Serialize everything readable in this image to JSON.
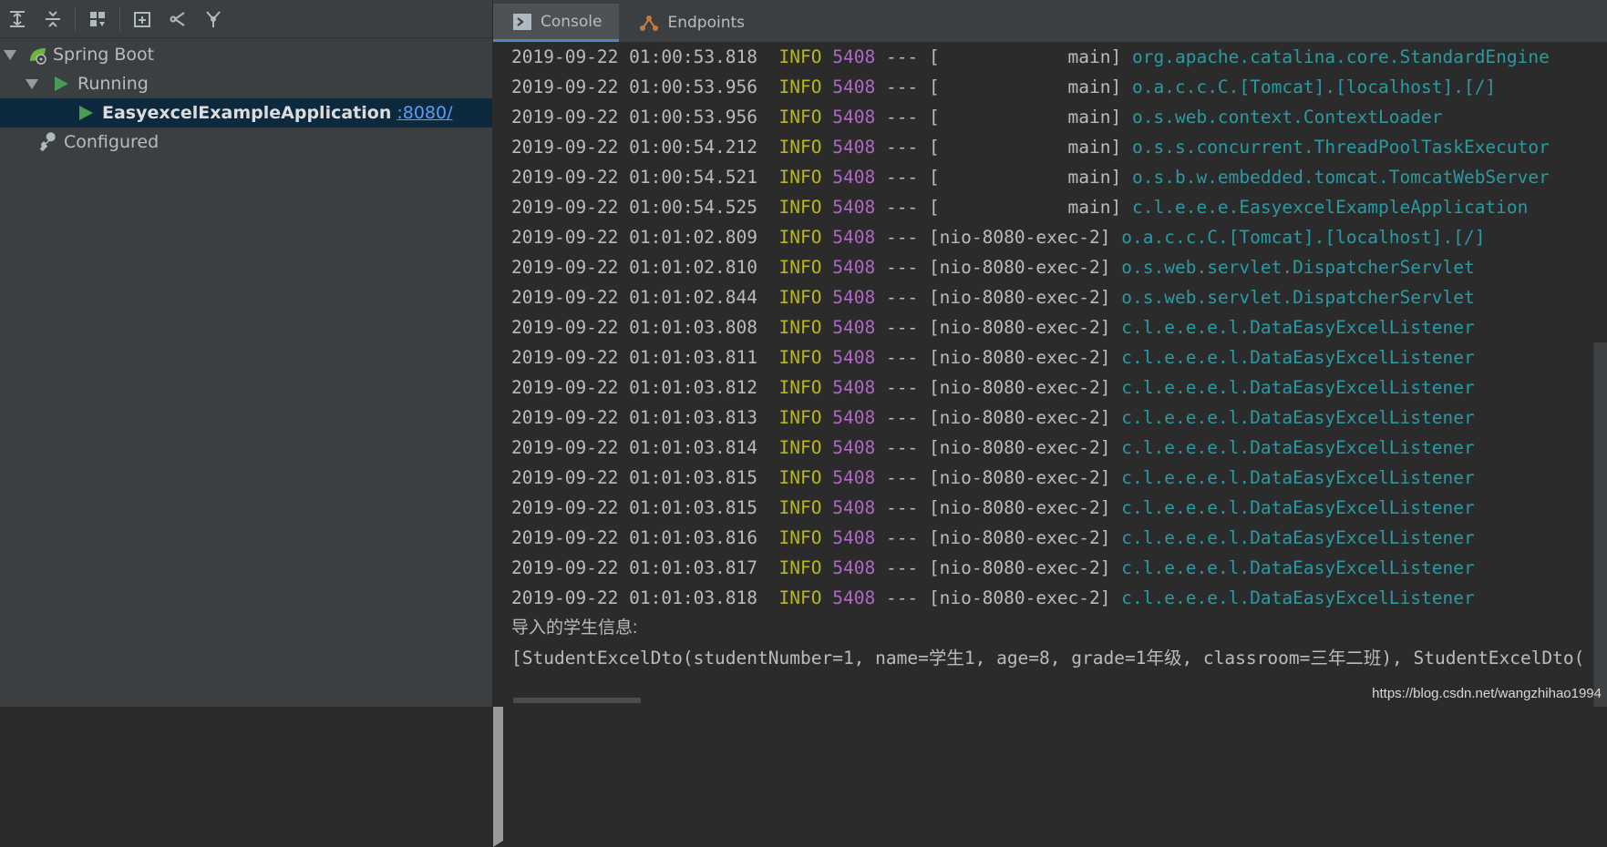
{
  "toolbar": {
    "icons": [
      "expand-all-icon",
      "collapse-all-icon",
      "group-by-icon",
      "new-service-icon",
      "filter-icon",
      "fork-icon"
    ]
  },
  "tree": {
    "root": {
      "label": "Spring Boot"
    },
    "running": {
      "label": "Running"
    },
    "app": {
      "label": "EasyexcelExampleApplication",
      "port_link": ":8080/"
    },
    "configured": {
      "label": "Configured"
    }
  },
  "tabs": [
    {
      "label": "Console",
      "icon": "console-icon",
      "active": true
    },
    {
      "label": "Endpoints",
      "icon": "endpoints-icon",
      "active": false
    }
  ],
  "console": {
    "lines": [
      {
        "date": "2019-09-22 01:00:53.818",
        "level": "INFO",
        "pid": "5408",
        "sep": "---",
        "thread": "[            main]",
        "logger": "org.apache.catalina.core.StandardEngine"
      },
      {
        "date": "2019-09-22 01:00:53.956",
        "level": "INFO",
        "pid": "5408",
        "sep": "---",
        "thread": "[            main]",
        "logger": "o.a.c.c.C.[Tomcat].[localhost].[/]"
      },
      {
        "date": "2019-09-22 01:00:53.956",
        "level": "INFO",
        "pid": "5408",
        "sep": "---",
        "thread": "[            main]",
        "logger": "o.s.web.context.ContextLoader"
      },
      {
        "date": "2019-09-22 01:00:54.212",
        "level": "INFO",
        "pid": "5408",
        "sep": "---",
        "thread": "[            main]",
        "logger": "o.s.s.concurrent.ThreadPoolTaskExecutor"
      },
      {
        "date": "2019-09-22 01:00:54.521",
        "level": "INFO",
        "pid": "5408",
        "sep": "---",
        "thread": "[            main]",
        "logger": "o.s.b.w.embedded.tomcat.TomcatWebServer"
      },
      {
        "date": "2019-09-22 01:00:54.525",
        "level": "INFO",
        "pid": "5408",
        "sep": "---",
        "thread": "[            main]",
        "logger": "c.l.e.e.e.EasyexcelExampleApplication"
      },
      {
        "date": "2019-09-22 01:01:02.809",
        "level": "INFO",
        "pid": "5408",
        "sep": "---",
        "thread": "[nio-8080-exec-2]",
        "logger": "o.a.c.c.C.[Tomcat].[localhost].[/]"
      },
      {
        "date": "2019-09-22 01:01:02.810",
        "level": "INFO",
        "pid": "5408",
        "sep": "---",
        "thread": "[nio-8080-exec-2]",
        "logger": "o.s.web.servlet.DispatcherServlet"
      },
      {
        "date": "2019-09-22 01:01:02.844",
        "level": "INFO",
        "pid": "5408",
        "sep": "---",
        "thread": "[nio-8080-exec-2]",
        "logger": "o.s.web.servlet.DispatcherServlet"
      },
      {
        "date": "2019-09-22 01:01:03.808",
        "level": "INFO",
        "pid": "5408",
        "sep": "---",
        "thread": "[nio-8080-exec-2]",
        "logger": "c.l.e.e.e.l.DataEasyExcelListener"
      },
      {
        "date": "2019-09-22 01:01:03.811",
        "level": "INFO",
        "pid": "5408",
        "sep": "---",
        "thread": "[nio-8080-exec-2]",
        "logger": "c.l.e.e.e.l.DataEasyExcelListener"
      },
      {
        "date": "2019-09-22 01:01:03.812",
        "level": "INFO",
        "pid": "5408",
        "sep": "---",
        "thread": "[nio-8080-exec-2]",
        "logger": "c.l.e.e.e.l.DataEasyExcelListener"
      },
      {
        "date": "2019-09-22 01:01:03.813",
        "level": "INFO",
        "pid": "5408",
        "sep": "---",
        "thread": "[nio-8080-exec-2]",
        "logger": "c.l.e.e.e.l.DataEasyExcelListener"
      },
      {
        "date": "2019-09-22 01:01:03.814",
        "level": "INFO",
        "pid": "5408",
        "sep": "---",
        "thread": "[nio-8080-exec-2]",
        "logger": "c.l.e.e.e.l.DataEasyExcelListener"
      },
      {
        "date": "2019-09-22 01:01:03.815",
        "level": "INFO",
        "pid": "5408",
        "sep": "---",
        "thread": "[nio-8080-exec-2]",
        "logger": "c.l.e.e.e.l.DataEasyExcelListener"
      },
      {
        "date": "2019-09-22 01:01:03.815",
        "level": "INFO",
        "pid": "5408",
        "sep": "---",
        "thread": "[nio-8080-exec-2]",
        "logger": "c.l.e.e.e.l.DataEasyExcelListener"
      },
      {
        "date": "2019-09-22 01:01:03.816",
        "level": "INFO",
        "pid": "5408",
        "sep": "---",
        "thread": "[nio-8080-exec-2]",
        "logger": "c.l.e.e.e.l.DataEasyExcelListener"
      },
      {
        "date": "2019-09-22 01:01:03.817",
        "level": "INFO",
        "pid": "5408",
        "sep": "---",
        "thread": "[nio-8080-exec-2]",
        "logger": "c.l.e.e.e.l.DataEasyExcelListener"
      },
      {
        "date": "2019-09-22 01:01:03.818",
        "level": "INFO",
        "pid": "5408",
        "sep": "---",
        "thread": "[nio-8080-exec-2]",
        "logger": "c.l.e.e.e.l.DataEasyExcelListener"
      }
    ],
    "import_header": "导入的学生信息:",
    "import_data": "[StudentExcelDto(studentNumber=1, name=学生1, age=8, grade=1年级, classroom=三年二班), StudentExcelDto("
  },
  "watermark": "https://blog.csdn.net/wangzhihao1994",
  "colors": {
    "level": "#b9b71e",
    "pid": "#b167c5",
    "logger": "#2a9aa3",
    "run_green": "#499c54",
    "link": "#589df6",
    "selection": "#0d293e"
  }
}
